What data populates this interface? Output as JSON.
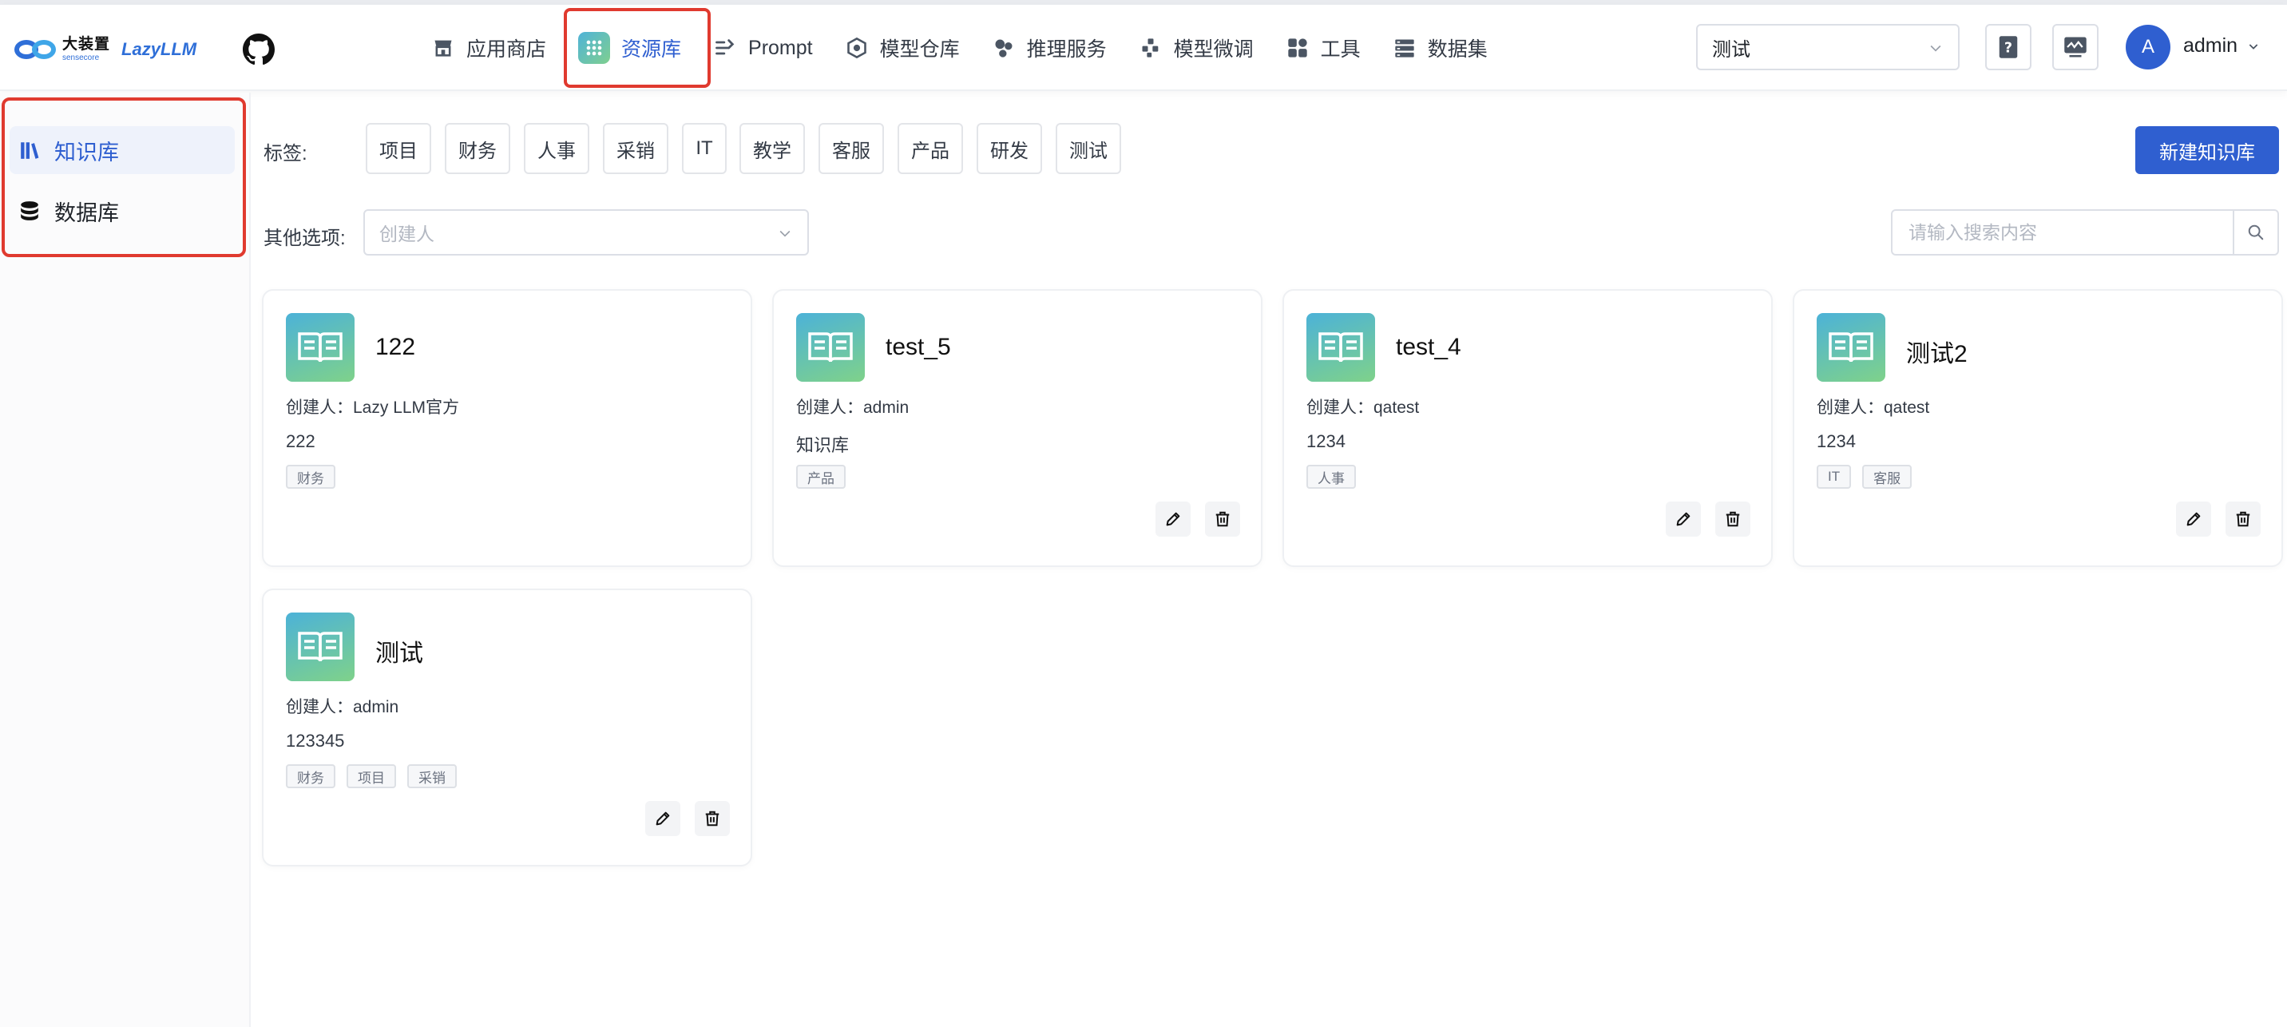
{
  "header": {
    "logo_cn": "大装置",
    "logo_sub": "sensecore",
    "logo_en": "LazyLLM",
    "nav": [
      {
        "label": "应用商店",
        "icon": "store-icon"
      },
      {
        "label": "资源库",
        "icon": "resource-icon",
        "active": true
      },
      {
        "label": "Prompt",
        "icon": "prompt-icon"
      },
      {
        "label": "模型仓库",
        "icon": "model-repo-icon"
      },
      {
        "label": "推理服务",
        "icon": "inference-icon"
      },
      {
        "label": "模型微调",
        "icon": "finetune-icon"
      },
      {
        "label": "工具",
        "icon": "tools-icon"
      },
      {
        "label": "数据集",
        "icon": "dataset-icon"
      }
    ],
    "project_select": "测试",
    "user": {
      "avatar_letter": "A",
      "name": "admin"
    }
  },
  "sidebar": {
    "items": [
      {
        "label": "知识库",
        "icon": "books-icon",
        "active": true
      },
      {
        "label": "数据库",
        "icon": "database-icon"
      }
    ]
  },
  "filters": {
    "tags_label": "标签:",
    "tags": [
      "项目",
      "财务",
      "人事",
      "采销",
      "IT",
      "教学",
      "客服",
      "产品",
      "研发",
      "测试"
    ],
    "other_label": "其他选项:",
    "creator_placeholder": "创建人",
    "search_placeholder": "请输入搜索内容",
    "new_button": "新建知识库"
  },
  "cards": [
    {
      "title": "122",
      "creator": "创建人：Lazy LLM官方",
      "desc": "222",
      "tags": [
        "财务"
      ],
      "actions": false
    },
    {
      "title": "test_5",
      "creator": "创建人：admin",
      "desc": "知识库",
      "tags": [
        "产品"
      ],
      "actions": true
    },
    {
      "title": "test_4",
      "creator": "创建人：qatest",
      "desc": "1234",
      "tags": [
        "人事"
      ],
      "actions": true
    },
    {
      "title": "测试2",
      "creator": "创建人：qatest",
      "desc": "1234",
      "tags": [
        "IT",
        "客服"
      ],
      "actions": true
    },
    {
      "title": "测试",
      "creator": "创建人：admin",
      "desc": "123345",
      "tags": [
        "财务",
        "项目",
        "采销"
      ],
      "actions": true
    }
  ],
  "colors": {
    "accent": "#2f5fd0",
    "highlight_box": "#e03a2f"
  }
}
